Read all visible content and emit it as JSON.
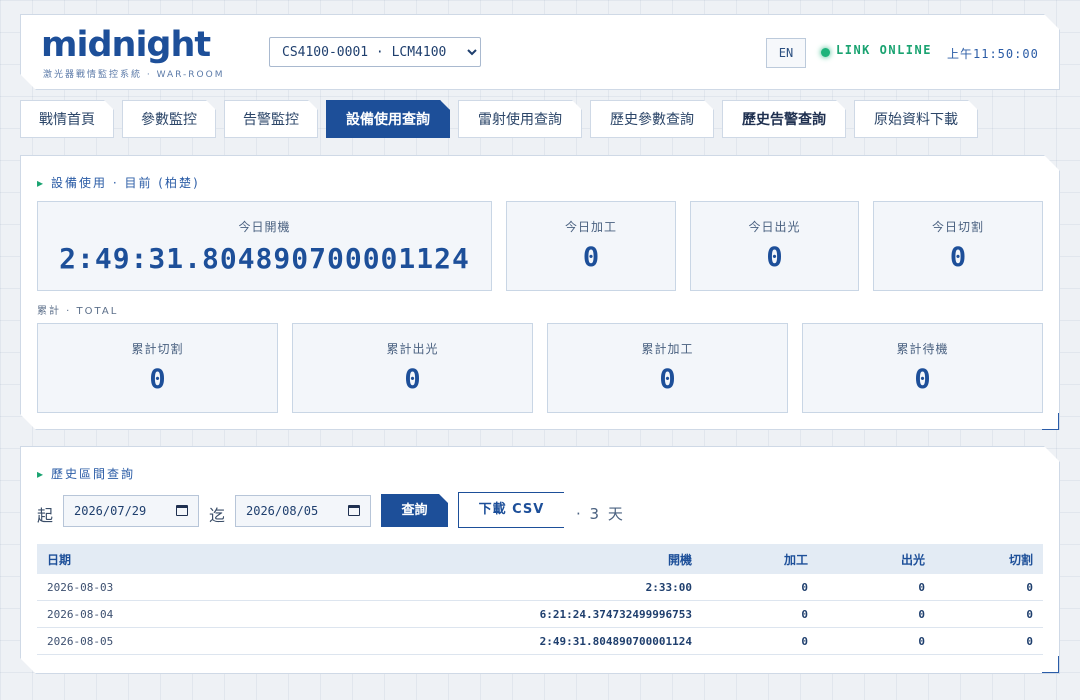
{
  "header": {
    "logo": "midnight",
    "subtitle": "激光器戰情監控系統 · WAR-ROOM",
    "device": "CS4100-0001 · LCM4100",
    "lang": "EN",
    "link_status": "LINK ONLINE",
    "clock": "上午11:50:00"
  },
  "tabs": [
    "戰情首頁",
    "參數監控",
    "告警監控",
    "設備使用查詢",
    "雷射使用查詢",
    "歷史參數查詢",
    "歷史告警查詢",
    "原始資料下載"
  ],
  "usage": {
    "title": "設備使用 · 目前 (柏楚)",
    "today": [
      {
        "label": "今日開機",
        "value": "2:49:31.804890700001124"
      },
      {
        "label": "今日加工",
        "value": "0"
      },
      {
        "label": "今日出光",
        "value": "0"
      },
      {
        "label": "今日切割",
        "value": "0"
      }
    ],
    "total_label": "累計 · TOTAL",
    "total": [
      {
        "label": "累計切割",
        "value": "0"
      },
      {
        "label": "累計出光",
        "value": "0"
      },
      {
        "label": "累計加工",
        "value": "0"
      },
      {
        "label": "累計待機",
        "value": "0"
      }
    ]
  },
  "history": {
    "title": "歷史區間查詢",
    "from_label": "起",
    "to_label": "迄",
    "from_date": "2026/07/29",
    "to_date": "2026/08/05",
    "query_label": "查詢",
    "csv_label": "下載 CSV",
    "days_label": "· 3 天",
    "columns": [
      "日期",
      "開機",
      "加工",
      "出光",
      "切割"
    ],
    "rows": [
      [
        "2026-08-03",
        "2:33:00",
        "0",
        "0",
        "0"
      ],
      [
        "2026-08-04",
        "6:21:24.374732499996753",
        "0",
        "0",
        "0"
      ],
      [
        "2026-08-05",
        "2:49:31.804890700001124",
        "0",
        "0",
        "0"
      ]
    ]
  },
  "colors": {
    "accent": "#1d4f99",
    "online": "#1aa371",
    "background": "#eef1f5"
  }
}
